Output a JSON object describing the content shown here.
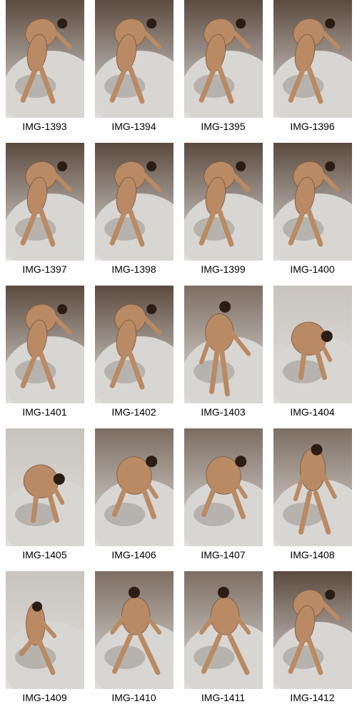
{
  "thumbnails": [
    {
      "label": "IMG-1393"
    },
    {
      "label": "IMG-1394"
    },
    {
      "label": "IMG-1395"
    },
    {
      "label": "IMG-1396"
    },
    {
      "label": "IMG-1397"
    },
    {
      "label": "IMG-1398"
    },
    {
      "label": "IMG-1399"
    },
    {
      "label": "IMG-1400"
    },
    {
      "label": "IMG-1401"
    },
    {
      "label": "IMG-1402"
    },
    {
      "label": "IMG-1403"
    },
    {
      "label": "IMG-1404"
    },
    {
      "label": "IMG-1405"
    },
    {
      "label": "IMG-1406"
    },
    {
      "label": "IMG-1407"
    },
    {
      "label": "IMG-1408"
    },
    {
      "label": "IMG-1409"
    },
    {
      "label": "IMG-1410"
    },
    {
      "label": "IMG-1411"
    },
    {
      "label": "IMG-1412"
    }
  ],
  "colors": {
    "page_bg": "#ffffff",
    "photo_wall_dark": "#5b4a3f",
    "photo_wall_light": "#c8c3bd",
    "platform": "#d8d6d2",
    "skin": "#b98a63",
    "shadow": "#8e8a85",
    "hair": "#2b1c14"
  }
}
